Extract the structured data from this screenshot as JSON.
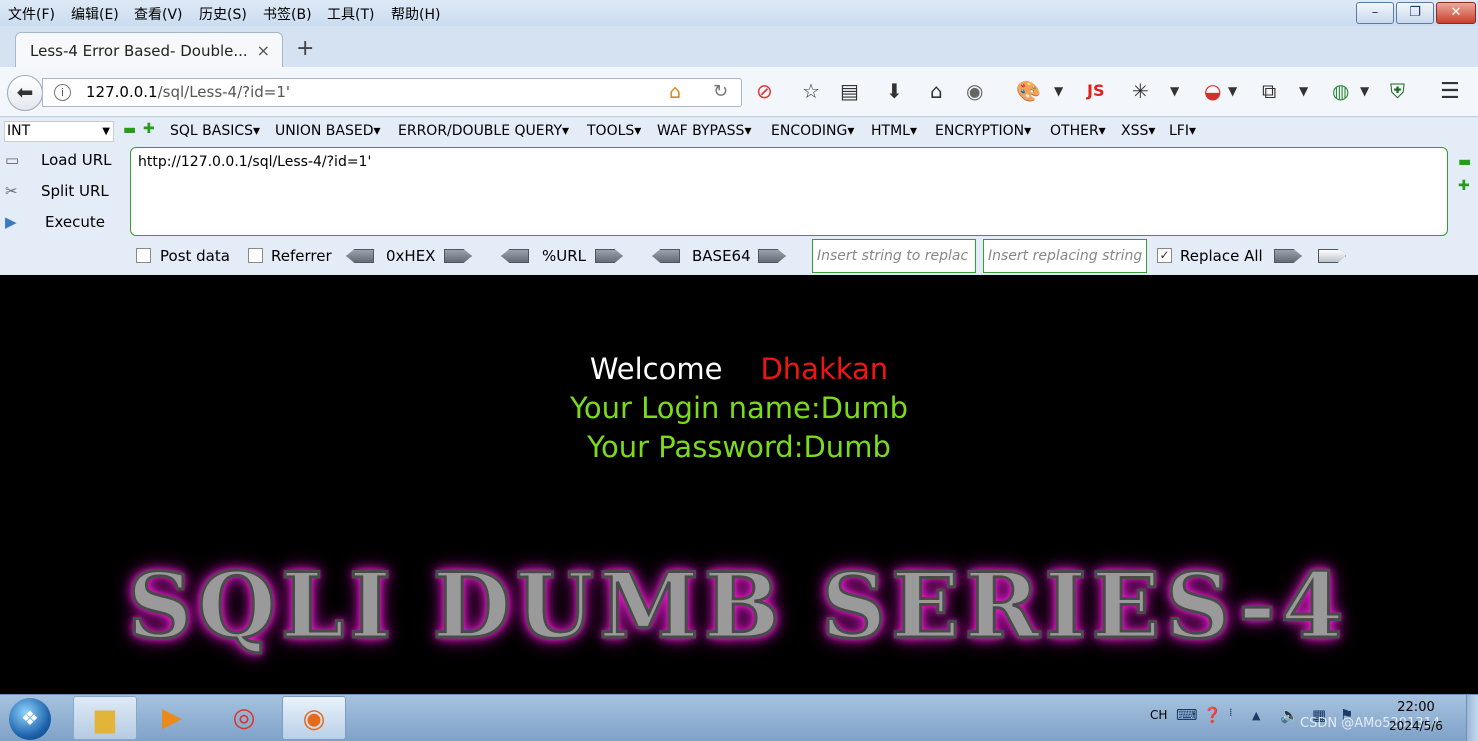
{
  "menubar": {
    "items": [
      "文件(F)",
      "编辑(E)",
      "查看(V)",
      "历史(S)",
      "书签(B)",
      "工具(T)",
      "帮助(H)"
    ]
  },
  "window_controls": {
    "minimize": "–",
    "maximize": "❐",
    "close": "✕"
  },
  "tab": {
    "title": "Less-4 Error Based- Double...",
    "close": "×",
    "new_tab": "+"
  },
  "navbar": {
    "url_host": "127.0.0.1",
    "url_path": "/sql/Less-4/?id=1'",
    "extension_js_label": "JS"
  },
  "hackbar": {
    "type_select": "INT",
    "menus": [
      "SQL BASICS",
      "UNION BASED",
      "ERROR/DOUBLE QUERY",
      "TOOLS",
      "WAF BYPASS",
      "ENCODING",
      "HTML",
      "ENCRYPTION",
      "OTHER",
      "XSS",
      "LFI"
    ],
    "actions": {
      "load": "Load URL",
      "split": "Split URL",
      "execute": "Execute"
    },
    "textarea_value": "http://127.0.0.1/sql/Less-4/?id=1'",
    "post_data_label": "Post data",
    "referrer_label": "Referrer",
    "hex_label": "0xHEX",
    "url_label": "%URL",
    "base64_label": "BASE64",
    "replace_from_placeholder": "Insert string to replac",
    "replace_to_placeholder": "Insert replacing string",
    "replace_all_label": "Replace All",
    "replace_all_checked": true
  },
  "page": {
    "welcome": "Welcome",
    "name": "Dhakkan",
    "login_line": "Your Login name:Dumb",
    "password_line": "Your Password:Dumb",
    "banner": "SQLI DUMB SERIES-4",
    "colors": {
      "background": "#000000",
      "welcome": "#ffffff",
      "name": "#ee1515",
      "info": "#7cda1c",
      "glow": "#ff20e0"
    }
  },
  "taskbar": {
    "input_lang": "CH",
    "time": "22:00",
    "date": "2024/5/6",
    "watermark": "CSDN @AMo5201314"
  }
}
